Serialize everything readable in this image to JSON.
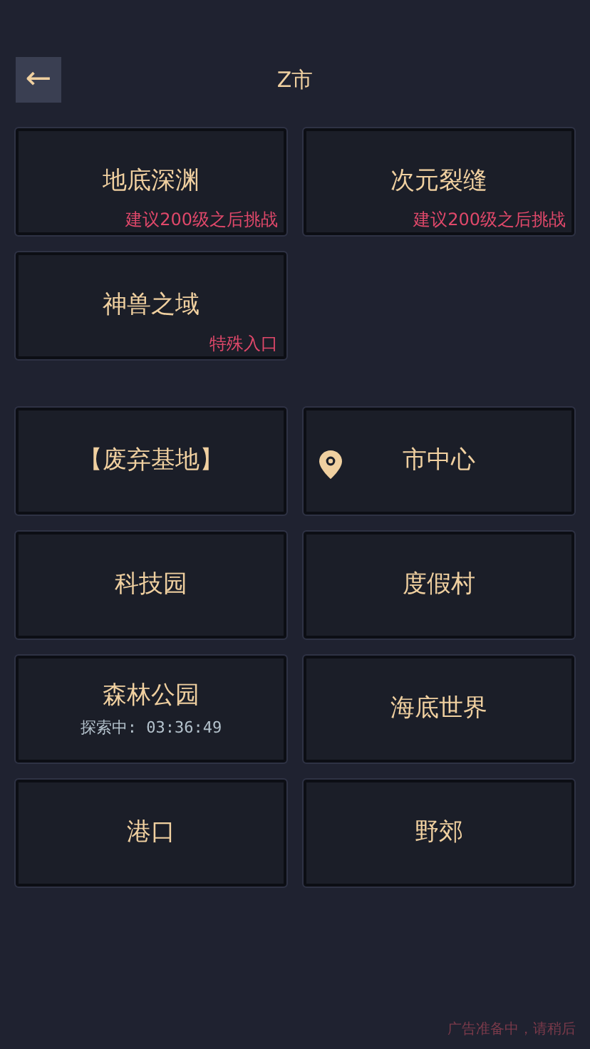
{
  "header": {
    "back": "←",
    "title": "Z市"
  },
  "dungeons": [
    {
      "name": "地底深渊",
      "note": "建议200级之后挑战"
    },
    {
      "name": "次元裂缝",
      "note": "建议200级之后挑战"
    },
    {
      "name": "神兽之域",
      "note": "特殊入口"
    }
  ],
  "locations": [
    {
      "name": "【废弃基地】",
      "current": false
    },
    {
      "name": "市中心",
      "current": true
    },
    {
      "name": "科技园",
      "current": false
    },
    {
      "name": "度假村",
      "current": false
    },
    {
      "name": "森林公园",
      "current": false,
      "status": "探索中: 03:36:49"
    },
    {
      "name": "海底世界",
      "current": false
    },
    {
      "name": "港口",
      "current": false
    },
    {
      "name": "野郊",
      "current": false
    }
  ],
  "footer": "广告准备中，请稍后"
}
